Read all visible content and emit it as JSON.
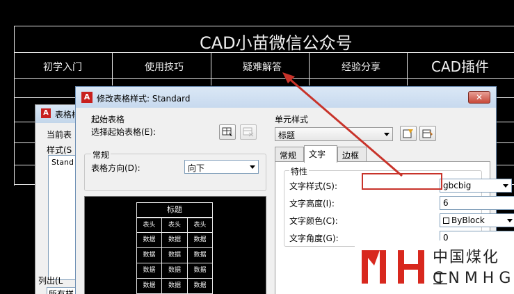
{
  "cad": {
    "title": "CAD小苗微信公众号",
    "headers": [
      "初学入门",
      "使用技巧",
      "疑难解答",
      "经验分享",
      "CAD插件"
    ]
  },
  "back_dialog": {
    "title": "表格样",
    "current_label": "当前表",
    "style_label": "样式(S",
    "list_item": "Stand",
    "list_out_label": "列出(L",
    "bottom_select": "所有样"
  },
  "dialog": {
    "title": "修改表格样式: Standard",
    "close_label": "✕",
    "start_table": {
      "group_label": "起始表格",
      "select_label": "选择起始表格(E):"
    },
    "general": {
      "group_label": "常规",
      "direction_label": "表格方向(D):",
      "direction_value": "向下"
    },
    "cell_style": {
      "group_label": "单元样式",
      "value": "标题"
    },
    "tabs": [
      {
        "label": "常规",
        "active": false
      },
      {
        "label": "文字",
        "active": true
      },
      {
        "label": "边框",
        "active": false
      }
    ],
    "properties": {
      "group_label": "特性",
      "text_style_label": "文字样式(S):",
      "text_style_value": "gbcbig",
      "browse_label": "...",
      "text_height_label": "文字高度(I):",
      "text_height_value": "6",
      "text_color_label": "文字颜色(C):",
      "text_color_value": "ByBlock",
      "text_angle_label": "文字角度(G):",
      "text_angle_value": "0"
    },
    "preview": {
      "title": "标题",
      "header": "表头",
      "data": "数据"
    }
  },
  "watermark": {
    "line1": "中国煤化工",
    "line2": "CNMHG"
  },
  "colors": {
    "highlight": "#c8332a",
    "brand_red": "#c8201e"
  }
}
